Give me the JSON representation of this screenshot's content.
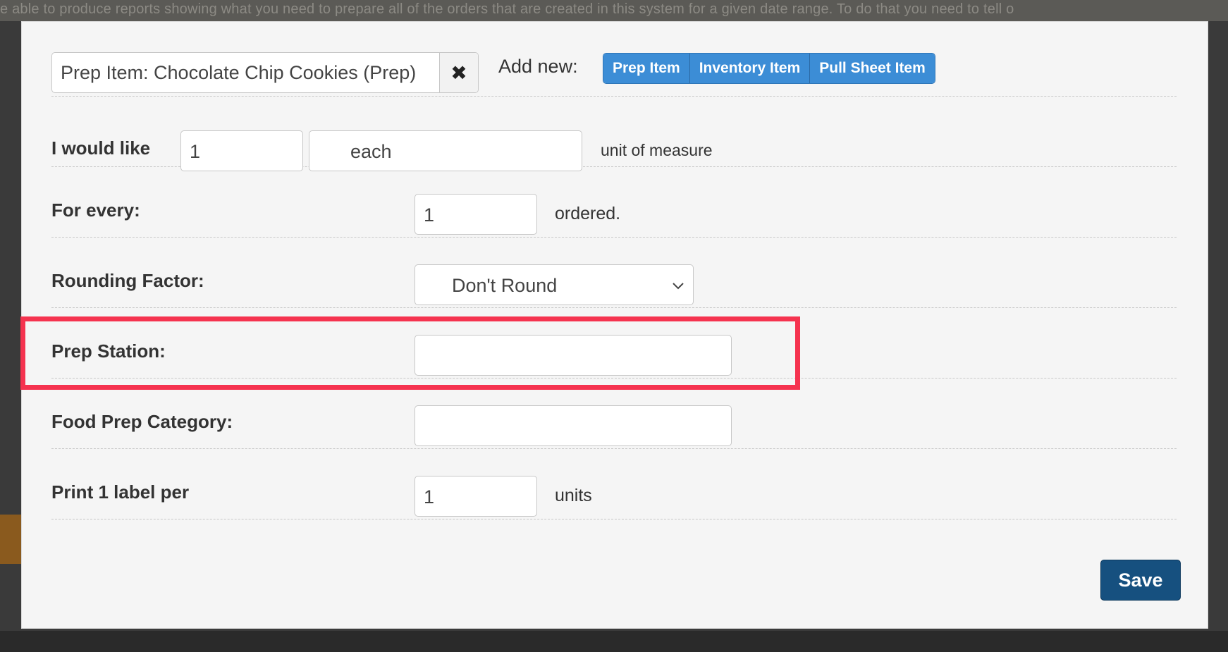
{
  "background": {
    "page_text": "e able to produce reports showing what you need to prepare all of the orders that are created in this system for a given date range. To do that you need to tell o"
  },
  "modal": {
    "item_select": {
      "value": "Prep Item: Chocolate Chip Cookies (Prep)",
      "clear_icon": "times-icon"
    },
    "add_new": {
      "label": "Add new:",
      "buttons": [
        "Prep Item",
        "Inventory Item",
        "Pull Sheet Item"
      ]
    },
    "rows": {
      "would_like": {
        "label": "I would like",
        "quantity": "1",
        "unit": "each",
        "suffix": "unit of measure"
      },
      "for_every": {
        "label": "For every:",
        "value": "1",
        "suffix": "ordered."
      },
      "rounding": {
        "label": "Rounding Factor:",
        "selected": "Don't Round",
        "arrow_icon": "chevron-down-icon"
      },
      "prep_station": {
        "label": "Prep Station:",
        "value": ""
      },
      "food_prep_category": {
        "label": "Food Prep Category:",
        "value": ""
      },
      "print_label": {
        "label": "Print 1 label per",
        "value": "1",
        "suffix": "units"
      }
    },
    "save_label": "Save"
  },
  "colors": {
    "highlight": "#f5334f",
    "primary_button": "#3c8dd6",
    "save_button": "#16507f"
  }
}
